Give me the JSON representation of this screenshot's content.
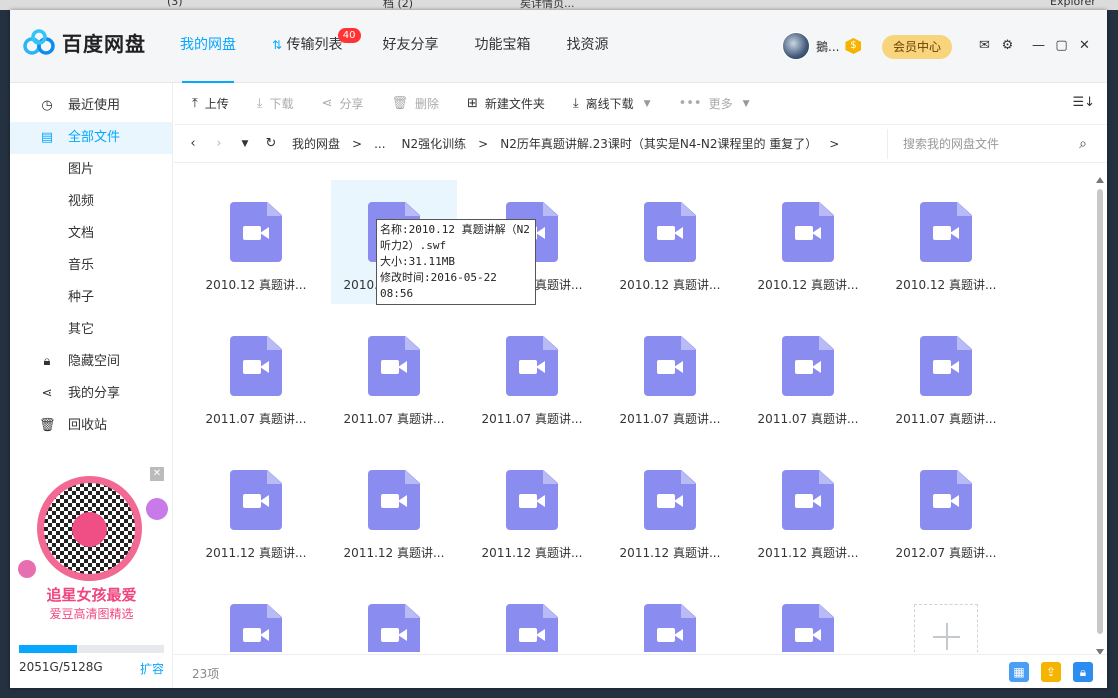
{
  "desktop": {
    "top_items": [
      "(3)",
      "档 (2)",
      "矣详情页...",
      "Explorer"
    ]
  },
  "app": {
    "logo_text": "百度网盘",
    "nav": [
      {
        "label": "我的网盘",
        "active": true
      },
      {
        "label": "传输列表",
        "badge": "40"
      },
      {
        "label": "好友分享"
      },
      {
        "label": "功能宝箱"
      },
      {
        "label": "找资源"
      }
    ],
    "user": {
      "name": "鵝...",
      "vip_badge": "$",
      "vip_button": "会员中心"
    }
  },
  "sidebar": {
    "items": [
      {
        "label": "最近使用",
        "icon": "clock-icon"
      },
      {
        "label": "全部文件",
        "icon": "file-icon",
        "active": true
      },
      {
        "label": "图片"
      },
      {
        "label": "视频"
      },
      {
        "label": "文档"
      },
      {
        "label": "音乐"
      },
      {
        "label": "种子"
      },
      {
        "label": "其它"
      },
      {
        "label": "隐藏空间",
        "icon": "lock-icon"
      },
      {
        "label": "我的分享",
        "icon": "share-icon"
      },
      {
        "label": "回收站",
        "icon": "trash-icon"
      }
    ],
    "promo": {
      "title": "追星女孩最爱",
      "subtitle": "爱豆高清图精选",
      "close": "✕"
    },
    "quota": {
      "used_fraction": 0.4,
      "text": "2051G/5128G",
      "expand": "扩容"
    }
  },
  "toolbar": {
    "upload": "上传",
    "download": "下载",
    "share": "分享",
    "delete": "删除",
    "new_folder": "新建文件夹",
    "offline": "离线下载",
    "more": "更多"
  },
  "pathbar": {
    "crumbs": [
      "我的网盘",
      ">",
      "...",
      "N2强化训练",
      ">",
      "N2历年真题讲解.23课时（其实是N4-N2课程里的 重复了）",
      ">"
    ],
    "search_placeholder": "搜索我的网盘文件"
  },
  "files": [
    "2010.12 真题讲...",
    "2010.12 真题讲...",
    "2010.12 真题讲...",
    "2010.12 真题讲...",
    "2010.12 真题讲...",
    "2010.12 真题讲...",
    "2011.07 真题讲...",
    "2011.07 真题讲...",
    "2011.07 真题讲...",
    "2011.07 真题讲...",
    "2011.07 真题讲...",
    "2011.07 真题讲...",
    "2011.12 真题讲...",
    "2011.12 真题讲...",
    "2011.12 真题讲...",
    "2011.12 真题讲...",
    "2011.12 真题讲...",
    "2012.07 真题讲...",
    "",
    "",
    "",
    "",
    ""
  ],
  "tooltip": {
    "line1": "名称:2010.12 真题讲解（N2",
    "line2": "听力2）.swf",
    "line3": "大小:31.11MB",
    "line4": "修改时间:2016-05-22 08:56"
  },
  "status": {
    "count": "23项"
  }
}
